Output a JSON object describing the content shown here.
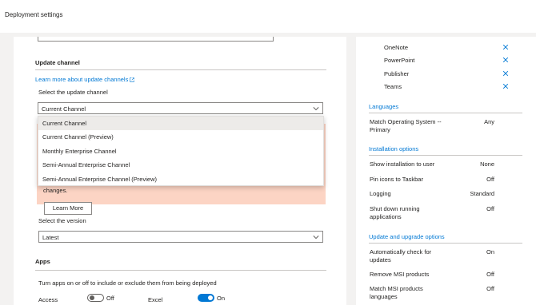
{
  "header": {
    "title": "Deployment settings"
  },
  "update_channel": {
    "title": "Update channel",
    "learn_link": "Learn more about update channels",
    "select_label": "Select the update channel",
    "selected": "Current Channel",
    "options": [
      "Current Channel",
      "Current Channel (Preview)",
      "Monthly Enterprise Channel",
      "Semi-Annual Enterprise Channel",
      "Semi-Annual Enterprise Channel (Preview)"
    ],
    "warning_tail": "changes.",
    "learn_more_button": "Learn More",
    "version_label": "Select the version",
    "version_selected": "Latest"
  },
  "apps": {
    "title": "Apps",
    "description": "Turn apps on or off to include or exclude them from being deployed",
    "toggles": [
      {
        "name": "Access",
        "state": "Off"
      },
      {
        "name": "Excel",
        "state": "On"
      }
    ]
  },
  "summary": {
    "apps": [
      "OneNote",
      "PowerPoint",
      "Publisher",
      "Teams"
    ],
    "languages": {
      "title": "Languages",
      "rows": [
        {
          "key": "Match Operating System --Primary",
          "value": "Any"
        }
      ]
    },
    "installation": {
      "title": "Installation options",
      "rows": [
        {
          "key": "Show installation to user",
          "value": "None"
        },
        {
          "key": "Pin icons to Taskbar",
          "value": "Off"
        },
        {
          "key": "Logging",
          "value": "Standard"
        },
        {
          "key": "Shut down running applications",
          "value": "Off"
        }
      ]
    },
    "updates": {
      "title": "Update and upgrade options",
      "rows": [
        {
          "key": "Automatically check for updates",
          "value": "On"
        },
        {
          "key": "Remove MSI products",
          "value": "Off"
        },
        {
          "key": "Match MSI products languages",
          "value": "Off"
        }
      ]
    }
  },
  "colors": {
    "accent": "#0078d4",
    "warning_bg": "#fcd4c4",
    "canvas": "#f3f2f1"
  }
}
